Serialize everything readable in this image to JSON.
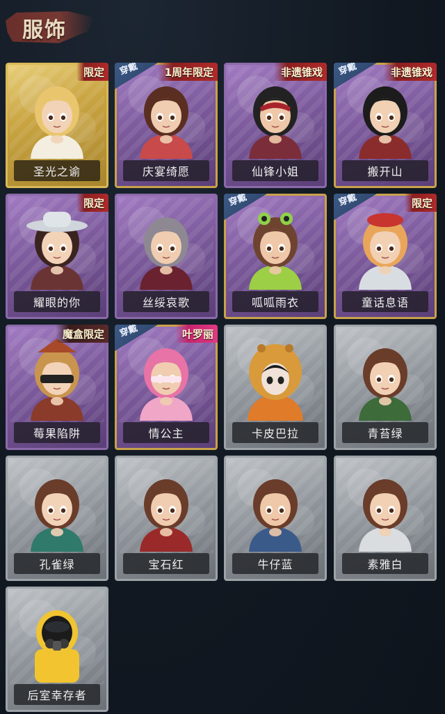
{
  "header": {
    "title": "服饰"
  },
  "colors": {
    "background": "#121a24",
    "gold_frame": "#d9b957",
    "purple_frame": "#8b6aa9",
    "grey_frame": "#9ea3a8",
    "equip_badge": "#3c5a86",
    "tag_badge": "#b02a2a"
  },
  "outfits": [
    {
      "name": "圣光之谕",
      "rarity": "gold",
      "equipped": false,
      "tag": "限定",
      "tag_style": "red",
      "icon": "blonde-veiled-girl-portrait-icon"
    },
    {
      "name": "庆宴绮愿",
      "rarity": "purple",
      "equipped": true,
      "tag": "1周年限定",
      "tag_style": "red",
      "icon": "birthday-cake-girl-portrait-icon"
    },
    {
      "name": "仙锋小姐",
      "rarity": "purple",
      "equipped": false,
      "tag": "非遗锥戏",
      "tag_style": "red",
      "icon": "opera-mask-girl-portrait-icon"
    },
    {
      "name": "搬开山",
      "rarity": "purple",
      "equipped": true,
      "tag": "非遗锥戏",
      "tag_style": "red",
      "icon": "warrior-boy-portrait-icon"
    },
    {
      "name": "耀眼的你",
      "rarity": "purple",
      "equipped": false,
      "tag": "限定",
      "tag_style": "red",
      "icon": "cowboy-hat-girl-portrait-icon"
    },
    {
      "name": "丝绥哀歌",
      "rarity": "purple",
      "equipped": false,
      "tag": "",
      "tag_style": "",
      "icon": "grey-hair-girl-portrait-icon"
    },
    {
      "name": "呱呱雨衣",
      "rarity": "purple",
      "equipped": true,
      "tag": "",
      "tag_style": "",
      "icon": "frog-hat-girl-portrait-icon"
    },
    {
      "name": "童话息语",
      "rarity": "purple",
      "equipped": true,
      "tag": "限定",
      "tag_style": "red",
      "icon": "red-beret-girl-portrait-icon"
    },
    {
      "name": "莓果陷阱",
      "rarity": "purple",
      "equipped": false,
      "tag": "魔盒限定",
      "tag_style": "dark",
      "icon": "blindfold-girl-portrait-icon"
    },
    {
      "name": "情公主",
      "rarity": "purple",
      "equipped": true,
      "tag": "叶罗丽",
      "tag_style": "pink",
      "icon": "pink-hair-princess-portrait-icon"
    },
    {
      "name": "卡皮巴拉",
      "rarity": "grey",
      "equipped": false,
      "tag": "",
      "tag_style": "",
      "icon": "capybara-hood-girl-portrait-icon"
    },
    {
      "name": "青苔绿",
      "rarity": "grey",
      "equipped": false,
      "tag": "",
      "tag_style": "",
      "icon": "green-scarf-girl-portrait-icon"
    },
    {
      "name": "孔雀绿",
      "rarity": "grey",
      "equipped": false,
      "tag": "",
      "tag_style": "",
      "icon": "peacock-scarf-girl-portrait-icon"
    },
    {
      "name": "宝石红",
      "rarity": "grey",
      "equipped": false,
      "tag": "",
      "tag_style": "",
      "icon": "red-scarf-girl-portrait-icon"
    },
    {
      "name": "牛仔蓝",
      "rarity": "grey",
      "equipped": false,
      "tag": "",
      "tag_style": "",
      "icon": "blue-scarf-girl-portrait-icon"
    },
    {
      "name": "素雅白",
      "rarity": "grey",
      "equipped": false,
      "tag": "",
      "tag_style": "",
      "icon": "white-scarf-girl-portrait-icon"
    },
    {
      "name": "后室幸存者",
      "rarity": "grey",
      "equipped": false,
      "tag": "",
      "tag_style": "",
      "icon": "gas-mask-survivor-portrait-icon"
    }
  ],
  "labels": {
    "equip": "穿戴"
  }
}
